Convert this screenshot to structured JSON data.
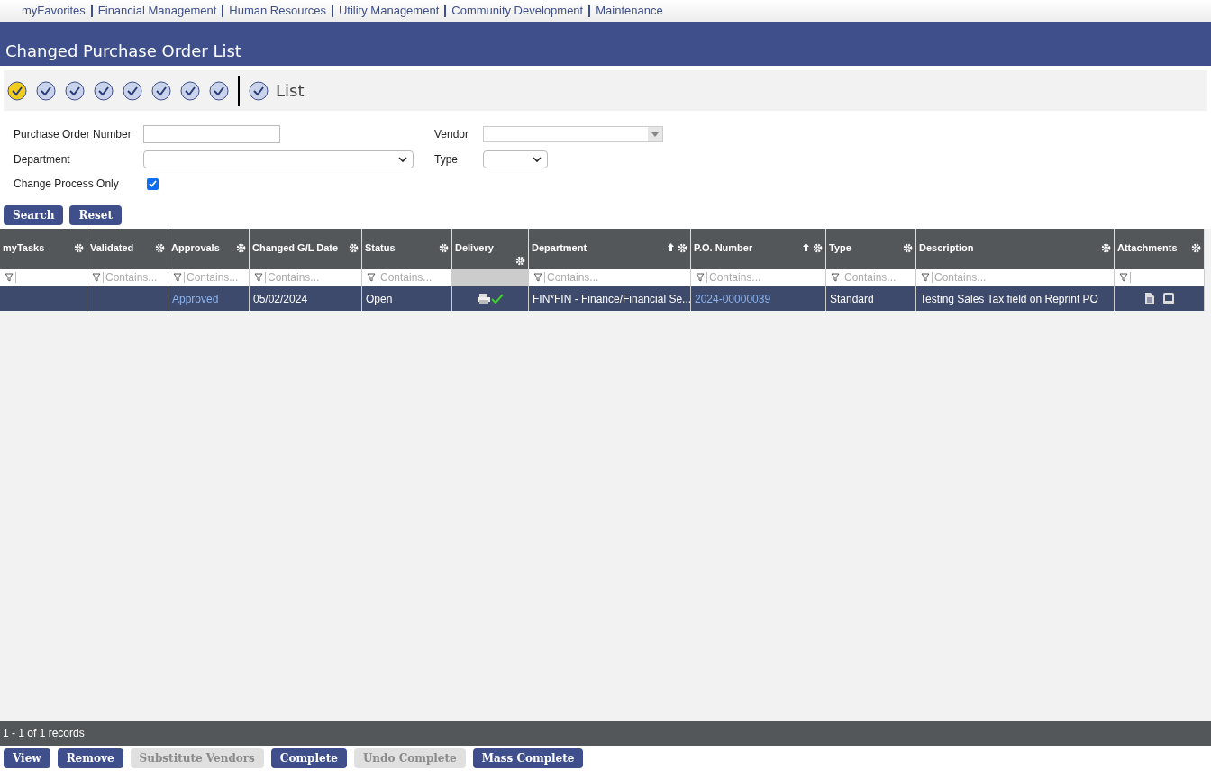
{
  "nav": [
    "myFavorites",
    "Financial Management",
    "Human Resources",
    "Utility Management",
    "Community Development",
    "Maintenance"
  ],
  "title": "Changed Purchase Order List",
  "toolbar": {
    "label": "List"
  },
  "form": {
    "po_number": {
      "label": "Purchase Order Number"
    },
    "vendor": {
      "label": "Vendor"
    },
    "department": {
      "label": "Department"
    },
    "type": {
      "label": "Type"
    },
    "change_process_only": {
      "label": "Change Process Only",
      "checked": true
    }
  },
  "form_buttons": [
    {
      "label": "Search",
      "disabled": false
    },
    {
      "label": "Reset",
      "disabled": false
    }
  ],
  "table": {
    "columns": [
      {
        "label": "myTasks",
        "sorted": false,
        "filter_disabled": false
      },
      {
        "label": "Validated",
        "sorted": false,
        "filter": "Contains...",
        "filter_disabled": false
      },
      {
        "label": "Approvals",
        "sorted": false,
        "filter": "Contains...",
        "filter_disabled": false
      },
      {
        "label": "Changed G/L Date",
        "sorted": false,
        "filter": "Contains...",
        "filter_disabled": false
      },
      {
        "label": "Status",
        "sorted": false,
        "filter": "Contains...",
        "filter_disabled": false
      },
      {
        "label": "Delivery",
        "sorted": false,
        "filter_disabled": true
      },
      {
        "label": "Department",
        "sorted": true,
        "filter": "Contains...",
        "filter_disabled": false
      },
      {
        "label": "P.O. Number",
        "sorted": true,
        "filter": "Contains...",
        "filter_disabled": false
      },
      {
        "label": "Type",
        "sorted": false,
        "filter": "Contains...",
        "filter_disabled": false
      },
      {
        "label": "Description",
        "sorted": false,
        "filter": "Contains...",
        "filter_disabled": false
      },
      {
        "label": "Attachments",
        "sorted": false,
        "filter_disabled": false
      }
    ],
    "rows": [
      {
        "cells": [
          {
            "kind": "empty"
          },
          {
            "kind": "empty"
          },
          {
            "kind": "link",
            "text": "Approved"
          },
          {
            "kind": "text",
            "text": "05/02/2024"
          },
          {
            "kind": "text",
            "text": "Open"
          },
          {
            "kind": "delivery"
          },
          {
            "kind": "text",
            "text": "FIN*FIN - Finance/Financial Se..."
          },
          {
            "kind": "link",
            "text": "2024-00000039"
          },
          {
            "kind": "text",
            "text": "Standard"
          },
          {
            "kind": "text",
            "text": "Testing Sales Tax field on Reprint PO"
          },
          {
            "kind": "attachments"
          }
        ]
      }
    ]
  },
  "status_bar": "1 - 1 of 1 records",
  "buttons": [
    {
      "label": "View",
      "disabled": false
    },
    {
      "label": "Remove",
      "disabled": false
    },
    {
      "label": "Substitute Vendors",
      "disabled": true
    },
    {
      "label": "Complete",
      "disabled": false
    },
    {
      "label": "Undo Complete",
      "disabled": true
    },
    {
      "label": "Mass Complete",
      "disabled": false
    }
  ]
}
